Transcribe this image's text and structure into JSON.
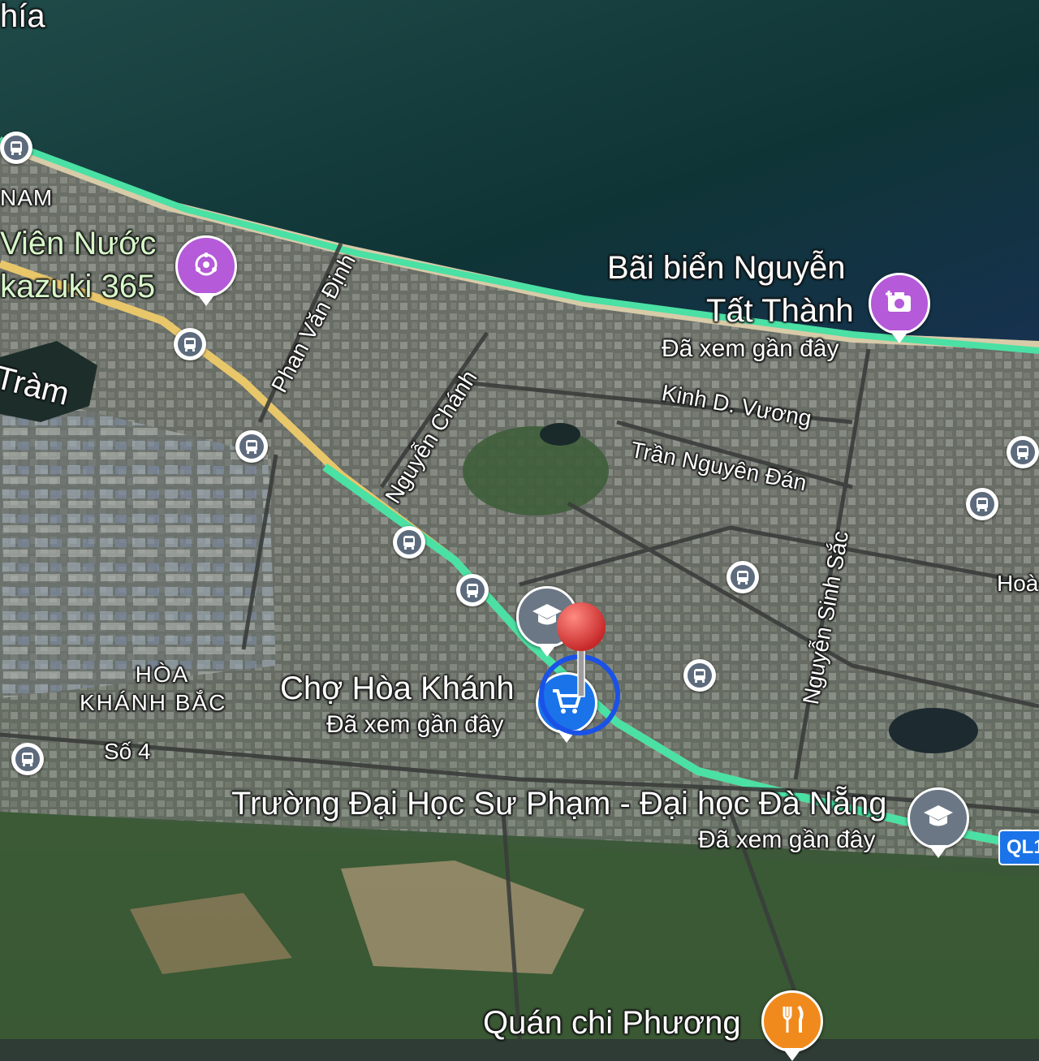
{
  "places": {
    "north_edge": "hía",
    "district_nam": "NAM",
    "water_park": "Viên Nước",
    "water_park_2": "kazuki 365",
    "tram_lake": "Tràm",
    "beach_name_1": "Bãi biển Nguyễn",
    "beach_name_2": "Tất Thành",
    "beach_sub": "Đã xem gần đây",
    "market": "Chợ Hòa Khánh",
    "market_sub": "Đã xem gần đây",
    "district_1": "HÒA",
    "district_2": "KHÁNH BẮC",
    "university": "Trường Đại Học Sư Phạm - Đại học Đà Nẵng",
    "university_sub": "Đã xem gần đây",
    "restaurant": "Quán chi Phương",
    "hoa_edge": "Hoà"
  },
  "streets": {
    "phan_van_dinh": "Phan Văn Định",
    "nguyen_chanh": "Nguyễn Chánh",
    "kinh_d_vuong": "Kinh D. Vương",
    "tran_nguyen_dan": "Trần Nguyên Đán",
    "nguyen_sinh_sac": "Nguyễn Sinh Sắc",
    "so_4": "Số 4"
  },
  "highway_shield": "QL1",
  "icons": {
    "market": "shopping-cart-icon",
    "university": "graduation-cap-icon",
    "school": "graduation-cap-icon",
    "beach": "add-photo-icon",
    "water_park": "attraction-icon",
    "restaurant": "fork-knife-icon",
    "bus_stop": "bus-icon",
    "dropped_pin": "map-pin-icon"
  },
  "colors": {
    "sea": "#123a3a",
    "land": "#56604f",
    "highway": "#4be0a4",
    "road_yellow": "#e8c66a",
    "market_pin": "#1a73e8",
    "attraction_pin": "#b55ad8",
    "school_pin": "#6b7785",
    "restaurant_pin": "#f08a1c",
    "dropped_pin": "#e53935"
  }
}
